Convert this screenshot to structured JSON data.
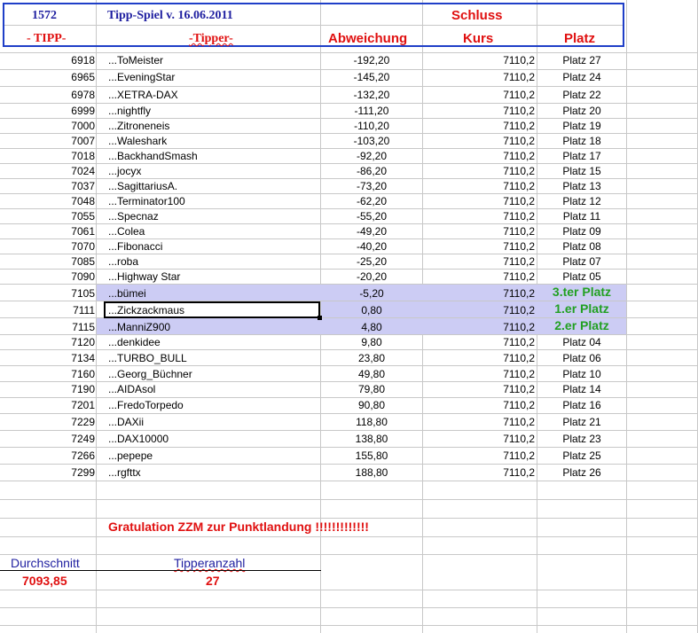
{
  "header": {
    "id": "1572",
    "title": "Tipp-Spiel v. 16.06.2011",
    "schluss": "Schluss",
    "col_tipp": "- TIPP-",
    "col_tipper": "-Tipper-",
    "col_abweichung": "Abweichung",
    "col_kurs": "Kurs",
    "col_platz": "Platz"
  },
  "rows": [
    {
      "tipp": "6918",
      "name": "...ToMeister",
      "abw": "-192,20",
      "kurs": "7110,2",
      "platz": "Platz 27"
    },
    {
      "tipp": "6965",
      "name": "...EveningStar",
      "abw": "-145,20",
      "kurs": "7110,2",
      "platz": "Platz 24"
    },
    {
      "tipp": "6978",
      "name": "...XETRA-DAX",
      "abw": "-132,20",
      "kurs": "7110,2",
      "platz": "Platz 22"
    },
    {
      "tipp": "6999",
      "name": "...nightfly",
      "abw": "-111,20",
      "kurs": "7110,2",
      "platz": "Platz 20"
    },
    {
      "tipp": "7000",
      "name": "...Zitroneneis",
      "abw": "-110,20",
      "kurs": "7110,2",
      "platz": "Platz 19"
    },
    {
      "tipp": "7007",
      "name": "...Waleshark",
      "abw": "-103,20",
      "kurs": "7110,2",
      "platz": "Platz 18"
    },
    {
      "tipp": "7018",
      "name": "...BackhandSmash",
      "abw": "-92,20",
      "kurs": "7110,2",
      "platz": "Platz 17"
    },
    {
      "tipp": "7024",
      "name": "...jocyx",
      "abw": "-86,20",
      "kurs": "7110,2",
      "platz": "Platz 15"
    },
    {
      "tipp": "7037",
      "name": "...SagittariusA.",
      "abw": "-73,20",
      "kurs": "7110,2",
      "platz": "Platz 13"
    },
    {
      "tipp": "7048",
      "name": "...Terminator100",
      "abw": "-62,20",
      "kurs": "7110,2",
      "platz": "Platz 12"
    },
    {
      "tipp": "7055",
      "name": "...Specnaz",
      "abw": "-55,20",
      "kurs": "7110,2",
      "platz": "Platz 11"
    },
    {
      "tipp": "7061",
      "name": "...Colea",
      "abw": "-49,20",
      "kurs": "7110,2",
      "platz": "Platz 09"
    },
    {
      "tipp": "7070",
      "name": "...Fibonacci",
      "abw": "-40,20",
      "kurs": "7110,2",
      "platz": "Platz 08"
    },
    {
      "tipp": "7085",
      "name": "...roba",
      "abw": "-25,20",
      "kurs": "7110,2",
      "platz": "Platz 07"
    },
    {
      "tipp": "7090",
      "name": "...Highway Star",
      "abw": "-20,20",
      "kurs": "7110,2",
      "platz": "Platz 05"
    },
    {
      "tipp": "7105",
      "name": "...bümei",
      "abw": "-5,20",
      "kurs": "7110,2",
      "platz": "3.ter Platz"
    },
    {
      "tipp": "7111",
      "name": "...Zickzackmaus",
      "abw": "0,80",
      "kurs": "7110,2",
      "platz": "1.er Platz"
    },
    {
      "tipp": "7115",
      "name": "...ManniZ900",
      "abw": "4,80",
      "kurs": "7110,2",
      "platz": "2.er Platz"
    },
    {
      "tipp": "7120",
      "name": "...denkidee",
      "abw": "9,80",
      "kurs": "7110,2",
      "platz": "Platz 04"
    },
    {
      "tipp": "7134",
      "name": "...TURBO_BULL",
      "abw": "23,80",
      "kurs": "7110,2",
      "platz": "Platz 06"
    },
    {
      "tipp": "7160",
      "name": "...Georg_Büchner",
      "abw": "49,80",
      "kurs": "7110,2",
      "platz": "Platz 10"
    },
    {
      "tipp": "7190",
      "name": "...AIDAsol",
      "abw": "79,80",
      "kurs": "7110,2",
      "platz": "Platz 14"
    },
    {
      "tipp": "7201",
      "name": "...FredoTorpedo",
      "abw": "90,80",
      "kurs": "7110,2",
      "platz": "Platz 16"
    },
    {
      "tipp": "7229",
      "name": "...DAXii",
      "abw": "118,80",
      "kurs": "7110,2",
      "platz": "Platz 21"
    },
    {
      "tipp": "7249",
      "name": "...DAX10000",
      "abw": "138,80",
      "kurs": "7110,2",
      "platz": "Platz 23"
    },
    {
      "tipp": "7266",
      "name": "...pepepe",
      "abw": "155,80",
      "kurs": "7110,2",
      "platz": "Platz 25"
    },
    {
      "tipp": "7299",
      "name": "...rgfttx",
      "abw": "188,80",
      "kurs": "7110,2",
      "platz": "Platz 26"
    }
  ],
  "message": "Gratulation ZZM zur Punktlandung !!!!!!!!!!!!!",
  "footer": {
    "durchschnitt_label": "Durchschnitt",
    "durchschnitt_value": "7093,85",
    "tipperanzahl_label": "Tipperanzahl",
    "tipperanzahl_value": "27"
  },
  "colors": {
    "header_border": "#1f3fc8",
    "highlight": "#ccccf4",
    "winner_text": "#22a022",
    "red_text": "#e01010",
    "blue_text": "#1f1fa0"
  }
}
